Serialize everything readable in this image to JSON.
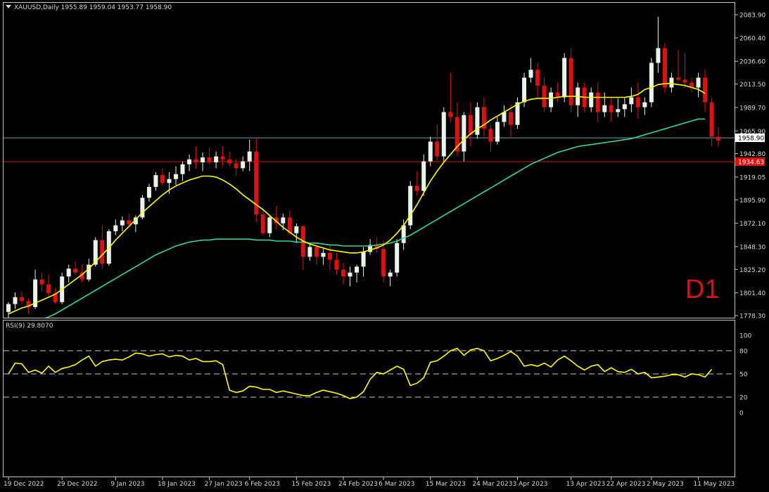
{
  "header": {
    "symbol_info": "XAUUSD,Daily  1955.89 1959.04 1953.77 1958.90",
    "rsi_info": "RSI(9) 29.8070",
    "timeframe_badge": "D1"
  },
  "colors": {
    "background": "#000000",
    "bull": "#e8f4e8",
    "bear": "#e01010",
    "ma_fast": "#ffff00",
    "ma_slow": "#30d898",
    "rsi": "#ffff00",
    "price_line": "#6fa0b8",
    "level_line": "#e01010",
    "text": "#d8d8d8"
  },
  "chart_data": [
    {
      "type": "candlestick",
      "title": "XAUUSD,Daily",
      "ohlc_header": [
        1955.89,
        1959.04,
        1953.77,
        1958.9
      ],
      "ylim": [
        1770.0,
        2090.0
      ],
      "price_ticks": [
        "2083.90",
        "2060.40",
        "2036.60",
        "2013.50",
        "1989.70",
        "1965.90",
        "1942.80",
        "1919.05",
        "1895.90",
        "1872.10",
        "1848.30",
        "1825.20",
        "1801.40",
        "1778.30"
      ],
      "date_ticks": [
        {
          "label": "19 Dec 2022",
          "i": 0
        },
        {
          "label": "29 Dec 2022",
          "i": 8
        },
        {
          "label": "9 Jan 2023",
          "i": 16
        },
        {
          "label": "18 Jan 2023",
          "i": 23
        },
        {
          "label": "27 Jan 2023",
          "i": 30
        },
        {
          "label": "6 Feb 2023",
          "i": 36
        },
        {
          "label": "15 Feb 2023",
          "i": 43
        },
        {
          "label": "24 Feb 2023",
          "i": 50
        },
        {
          "label": "6 Mar 2023",
          "i": 56
        },
        {
          "label": "15 Mar 2023",
          "i": 63
        },
        {
          "label": "24 Mar 2023",
          "i": 70
        },
        {
          "label": "3 Apr 2023",
          "i": 76
        },
        {
          "label": "13 Apr 2023",
          "i": 84
        },
        {
          "label": "22 Apr 2023",
          "i": 90
        },
        {
          "label": "2 May 2023",
          "i": 96
        },
        {
          "label": "11 May 2023",
          "i": 103
        }
      ],
      "current_price": "1958.90",
      "level_price": "1934.63",
      "candles": [
        [
          1782,
          1792,
          1775,
          1790
        ],
        [
          1790,
          1802,
          1785,
          1797
        ],
        [
          1797,
          1803,
          1790,
          1793
        ],
        [
          1793,
          1796,
          1780,
          1787
        ],
        [
          1787,
          1825,
          1785,
          1815
        ],
        [
          1815,
          1822,
          1803,
          1810
        ],
        [
          1810,
          1820,
          1798,
          1801
        ],
        [
          1801,
          1806,
          1790,
          1792
        ],
        [
          1792,
          1822,
          1790,
          1818
        ],
        [
          1818,
          1830,
          1812,
          1826
        ],
        [
          1826,
          1833,
          1820,
          1822
        ],
        [
          1822,
          1830,
          1812,
          1815
        ],
        [
          1815,
          1836,
          1813,
          1830
        ],
        [
          1830,
          1858,
          1828,
          1855
        ],
        [
          1855,
          1870,
          1826,
          1831
        ],
        [
          1831,
          1866,
          1829,
          1864
        ],
        [
          1864,
          1876,
          1860,
          1870
        ],
        [
          1870,
          1879,
          1864,
          1875
        ],
        [
          1875,
          1882,
          1868,
          1871
        ],
        [
          1871,
          1880,
          1863,
          1878
        ],
        [
          1878,
          1901,
          1876,
          1898
        ],
        [
          1898,
          1912,
          1894,
          1909
        ],
        [
          1909,
          1924,
          1905,
          1921
        ],
        [
          1921,
          1928,
          1910,
          1913
        ],
        [
          1913,
          1924,
          1902,
          1917
        ],
        [
          1917,
          1930,
          1911,
          1922
        ],
        [
          1922,
          1935,
          1915,
          1932
        ],
        [
          1932,
          1942,
          1925,
          1937
        ],
        [
          1937,
          1950,
          1928,
          1934
        ],
        [
          1934,
          1944,
          1925,
          1939
        ],
        [
          1939,
          1949,
          1932,
          1934
        ],
        [
          1934,
          1945,
          1928,
          1940
        ],
        [
          1940,
          1950,
          1930,
          1937
        ],
        [
          1937,
          1945,
          1930,
          1933
        ],
        [
          1933,
          1937,
          1920,
          1928
        ],
        [
          1928,
          1940,
          1925,
          1935
        ],
        [
          1935,
          1957,
          1925,
          1945
        ],
        [
          1945,
          1958,
          1873,
          1881
        ],
        [
          1881,
          1888,
          1860,
          1862
        ],
        [
          1862,
          1880,
          1858,
          1878
        ],
        [
          1878,
          1890,
          1866,
          1872
        ],
        [
          1872,
          1882,
          1865,
          1878
        ],
        [
          1878,
          1885,
          1860,
          1862
        ],
        [
          1862,
          1872,
          1852,
          1869
        ],
        [
          1869,
          1870,
          1825,
          1838
        ],
        [
          1838,
          1852,
          1834,
          1848
        ],
        [
          1848,
          1852,
          1830,
          1838
        ],
        [
          1838,
          1846,
          1830,
          1842
        ],
        [
          1842,
          1850,
          1825,
          1835
        ],
        [
          1835,
          1842,
          1820,
          1825
        ],
        [
          1825,
          1832,
          1810,
          1818
        ],
        [
          1818,
          1828,
          1808,
          1822
        ],
        [
          1822,
          1830,
          1812,
          1828
        ],
        [
          1828,
          1848,
          1818,
          1843
        ],
        [
          1843,
          1856,
          1840,
          1850
        ],
        [
          1850,
          1858,
          1842,
          1846
        ],
        [
          1846,
          1855,
          1812,
          1818
        ],
        [
          1818,
          1825,
          1808,
          1822
        ],
        [
          1822,
          1856,
          1818,
          1852
        ],
        [
          1852,
          1876,
          1845,
          1870
        ],
        [
          1870,
          1915,
          1866,
          1910
        ],
        [
          1910,
          1925,
          1900,
          1905
        ],
        [
          1905,
          1942,
          1900,
          1935
        ],
        [
          1935,
          1960,
          1930,
          1955
        ],
        [
          1955,
          1972,
          1935,
          1940
        ],
        [
          1940,
          1990,
          1935,
          1985
        ],
        [
          1985,
          2025,
          1975,
          1980
        ],
        [
          1980,
          1995,
          1940,
          1945
        ],
        [
          1945,
          1985,
          1935,
          1982
        ],
        [
          1982,
          1995,
          1950,
          1962
        ],
        [
          1962,
          1995,
          1958,
          1990
        ],
        [
          1990,
          2000,
          1960,
          1968
        ],
        [
          1968,
          1972,
          1945,
          1955
        ],
        [
          1955,
          1980,
          1952,
          1975
        ],
        [
          1975,
          1992,
          1970,
          1985
        ],
        [
          1985,
          1993,
          1960,
          1972
        ],
        [
          1972,
          2000,
          1968,
          1995
        ],
        [
          1995,
          2025,
          1990,
          2020
        ],
        [
          2020,
          2040,
          2015,
          2028
        ],
        [
          2028,
          2035,
          2000,
          2012
        ],
        [
          2012,
          2020,
          1985,
          1990
        ],
        [
          1990,
          2010,
          1985,
          2005
        ],
        [
          2005,
          2015,
          1995,
          2000
        ],
        [
          2000,
          2045,
          1995,
          2040
        ],
        [
          2040,
          2050,
          1985,
          1992
        ],
        [
          1992,
          2015,
          1980,
          2010
        ],
        [
          2010,
          2015,
          1985,
          1990
        ],
        [
          1990,
          2010,
          1985,
          2005
        ],
        [
          2005,
          2015,
          1975,
          1985
        ],
        [
          1985,
          2005,
          1980,
          1992
        ],
        [
          1992,
          2000,
          1975,
          1985
        ],
        [
          1985,
          1999,
          1980,
          1988
        ],
        [
          1988,
          2000,
          1980,
          1993
        ],
        [
          1993,
          2010,
          1985,
          2000
        ],
        [
          2000,
          2015,
          1978,
          1990
        ],
        [
          1990,
          2000,
          1982,
          1995
        ],
        [
          1995,
          2040,
          1990,
          2035
        ],
        [
          2035,
          2082,
          2025,
          2050
        ],
        [
          2050,
          2055,
          2005,
          2010
        ],
        [
          2010,
          2025,
          2005,
          2020
        ],
        [
          2020,
          2048,
          2015,
          2018
        ],
        [
          2018,
          2045,
          2010,
          2015
        ],
        [
          2015,
          2020,
          2005,
          2010
        ],
        [
          2010,
          2025,
          2000,
          2020
        ],
        [
          2020,
          2028,
          1985,
          1995
        ],
        [
          1995,
          2000,
          1950,
          1960
        ],
        [
          1960,
          1970,
          1950,
          1956
        ]
      ],
      "ma_fast": [
        1780,
        1783,
        1786,
        1788,
        1791,
        1794,
        1797,
        1800,
        1805,
        1810,
        1815,
        1820,
        1826,
        1833,
        1840,
        1847,
        1855,
        1862,
        1869,
        1876,
        1883,
        1889,
        1895,
        1901,
        1906,
        1910,
        1913,
        1916,
        1918,
        1920,
        1920,
        1919,
        1916,
        1912,
        1907,
        1901,
        1896,
        1891,
        1886,
        1880,
        1874,
        1868,
        1863,
        1858,
        1854,
        1851,
        1849,
        1847,
        1845,
        1844,
        1843,
        1842,
        1842,
        1843,
        1845,
        1847,
        1850,
        1855,
        1862,
        1870,
        1880,
        1891,
        1903,
        1915,
        1925,
        1934,
        1942,
        1950,
        1957,
        1963,
        1968,
        1972,
        1977,
        1981,
        1985,
        1989,
        1993,
        1996,
        1998,
        1999,
        1999,
        1999,
        2000,
        2001,
        2001,
        2001,
        2000,
        2000,
        2000,
        2000,
        2000,
        2000,
        2000,
        2001,
        2003,
        2008,
        2010,
        2013,
        2014,
        2014,
        2013,
        2012,
        2010,
        2008,
        2004
      ],
      "ma_slow": [
        1762,
        1764,
        1766,
        1768,
        1771,
        1774,
        1777,
        1780,
        1784,
        1788,
        1792,
        1796,
        1800,
        1804,
        1808,
        1812,
        1816,
        1820,
        1824,
        1828,
        1832,
        1836,
        1840,
        1843,
        1846,
        1849,
        1851,
        1853,
        1854,
        1855,
        1855,
        1856,
        1856,
        1856,
        1856,
        1856,
        1856,
        1855,
        1855,
        1855,
        1854,
        1854,
        1854,
        1853,
        1853,
        1852,
        1852,
        1851,
        1850,
        1850,
        1849,
        1849,
        1849,
        1849,
        1849,
        1850,
        1851,
        1852,
        1854,
        1857,
        1860,
        1864,
        1868,
        1872,
        1876,
        1880,
        1884,
        1888,
        1892,
        1896,
        1900,
        1904,
        1908,
        1912,
        1916,
        1920,
        1924,
        1928,
        1932,
        1935,
        1938,
        1941,
        1944,
        1946,
        1948,
        1950,
        1951,
        1952,
        1953,
        1954,
        1955,
        1956,
        1957,
        1958,
        1960,
        1962,
        1964,
        1966,
        1968,
        1970,
        1972,
        1974,
        1976,
        1978,
        1978
      ]
    },
    {
      "type": "line",
      "title": "RSI(9) 29.8070",
      "ylim": [
        0,
        100
      ],
      "y_ticks": [
        "100",
        "80",
        "50",
        "20",
        "0"
      ],
      "levels": [
        80,
        50,
        20
      ],
      "rsi": [
        50,
        64,
        63,
        52,
        55,
        51,
        60,
        52,
        57,
        59,
        62,
        68,
        73,
        60,
        66,
        68,
        69,
        68,
        72,
        77,
        76,
        73,
        75,
        76,
        72,
        74,
        73,
        68,
        70,
        66,
        66,
        67,
        62,
        29,
        26,
        28,
        34,
        33,
        30,
        30,
        26,
        28,
        26,
        24,
        22,
        22,
        26,
        29,
        27,
        25,
        22,
        18,
        20,
        27,
        43,
        52,
        50,
        55,
        60,
        56,
        35,
        38,
        45,
        65,
        67,
        73,
        80,
        83,
        74,
        81,
        83,
        80,
        67,
        70,
        74,
        79,
        73,
        60,
        62,
        60,
        64,
        59,
        68,
        73,
        67,
        60,
        55,
        60,
        62,
        53,
        58,
        53,
        52,
        56,
        50,
        52,
        45,
        46,
        47,
        49,
        49,
        46,
        50,
        49,
        46,
        56
      ]
    }
  ]
}
